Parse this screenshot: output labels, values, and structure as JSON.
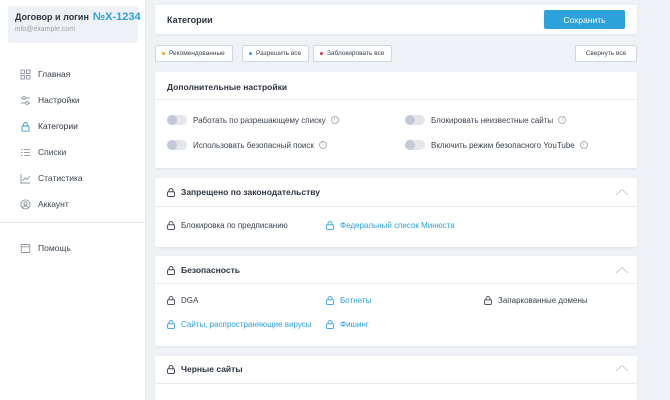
{
  "account": {
    "title": "Договор и логин",
    "number": "№X-1234",
    "email": "info@example.com"
  },
  "nav": {
    "items": [
      {
        "label": "Главная",
        "icon": "grid-icon"
      },
      {
        "label": "Настройки",
        "icon": "sliders-icon"
      },
      {
        "label": "Категории",
        "icon": "lock-icon"
      },
      {
        "label": "Списки",
        "icon": "list-icon"
      },
      {
        "label": "Статистика",
        "icon": "chart-icon"
      },
      {
        "label": "Аккаунт",
        "icon": "user-icon"
      }
    ],
    "help": {
      "label": "Помощь",
      "icon": "help-icon"
    }
  },
  "header": {
    "title": "Категории",
    "save_label": "Сохранить"
  },
  "filters": {
    "chips": [
      {
        "label": "Рекомендованные",
        "dot_color": "#f5a623"
      },
      {
        "label": "Разрешить все",
        "dot_color": "#2da1dc"
      },
      {
        "label": "Заблокировать все",
        "dot_color": "#e0344a"
      }
    ],
    "collapse_label": "Свернуть все"
  },
  "advanced": {
    "title": "Дополнительные настройки",
    "toggles": [
      {
        "label": "Работать по разрешающему списку",
        "on": false
      },
      {
        "label": "Блокировать неизвестные сайты",
        "on": false
      },
      {
        "label": "Использовать безопасный поиск",
        "on": false
      },
      {
        "label": "Включить режим безопасного YouTube",
        "on": false
      }
    ],
    "info_glyph": "i"
  },
  "categories": [
    {
      "title": "Запрещено по законодательству",
      "items": [
        {
          "label": "Блокировка по предписанию",
          "style": "dark"
        },
        {
          "label": "Федеральный список Минюста",
          "style": "blue"
        }
      ]
    },
    {
      "title": "Безопасность",
      "items": [
        {
          "label": "DGA",
          "style": "dark"
        },
        {
          "label": "Ботнеты",
          "style": "blue"
        },
        {
          "label": "Запаркованные домены",
          "style": "dark"
        },
        {
          "label": "Сайты, распространяющие вирусы",
          "style": "blue"
        },
        {
          "label": "Фишинг",
          "style": "blue"
        }
      ]
    },
    {
      "title": "Черные сайты",
      "items": []
    }
  ],
  "colors": {
    "accent": "#2da1dc",
    "text": "#2b3340",
    "muted": "#9aa3ad",
    "background": "#eef1f5"
  }
}
